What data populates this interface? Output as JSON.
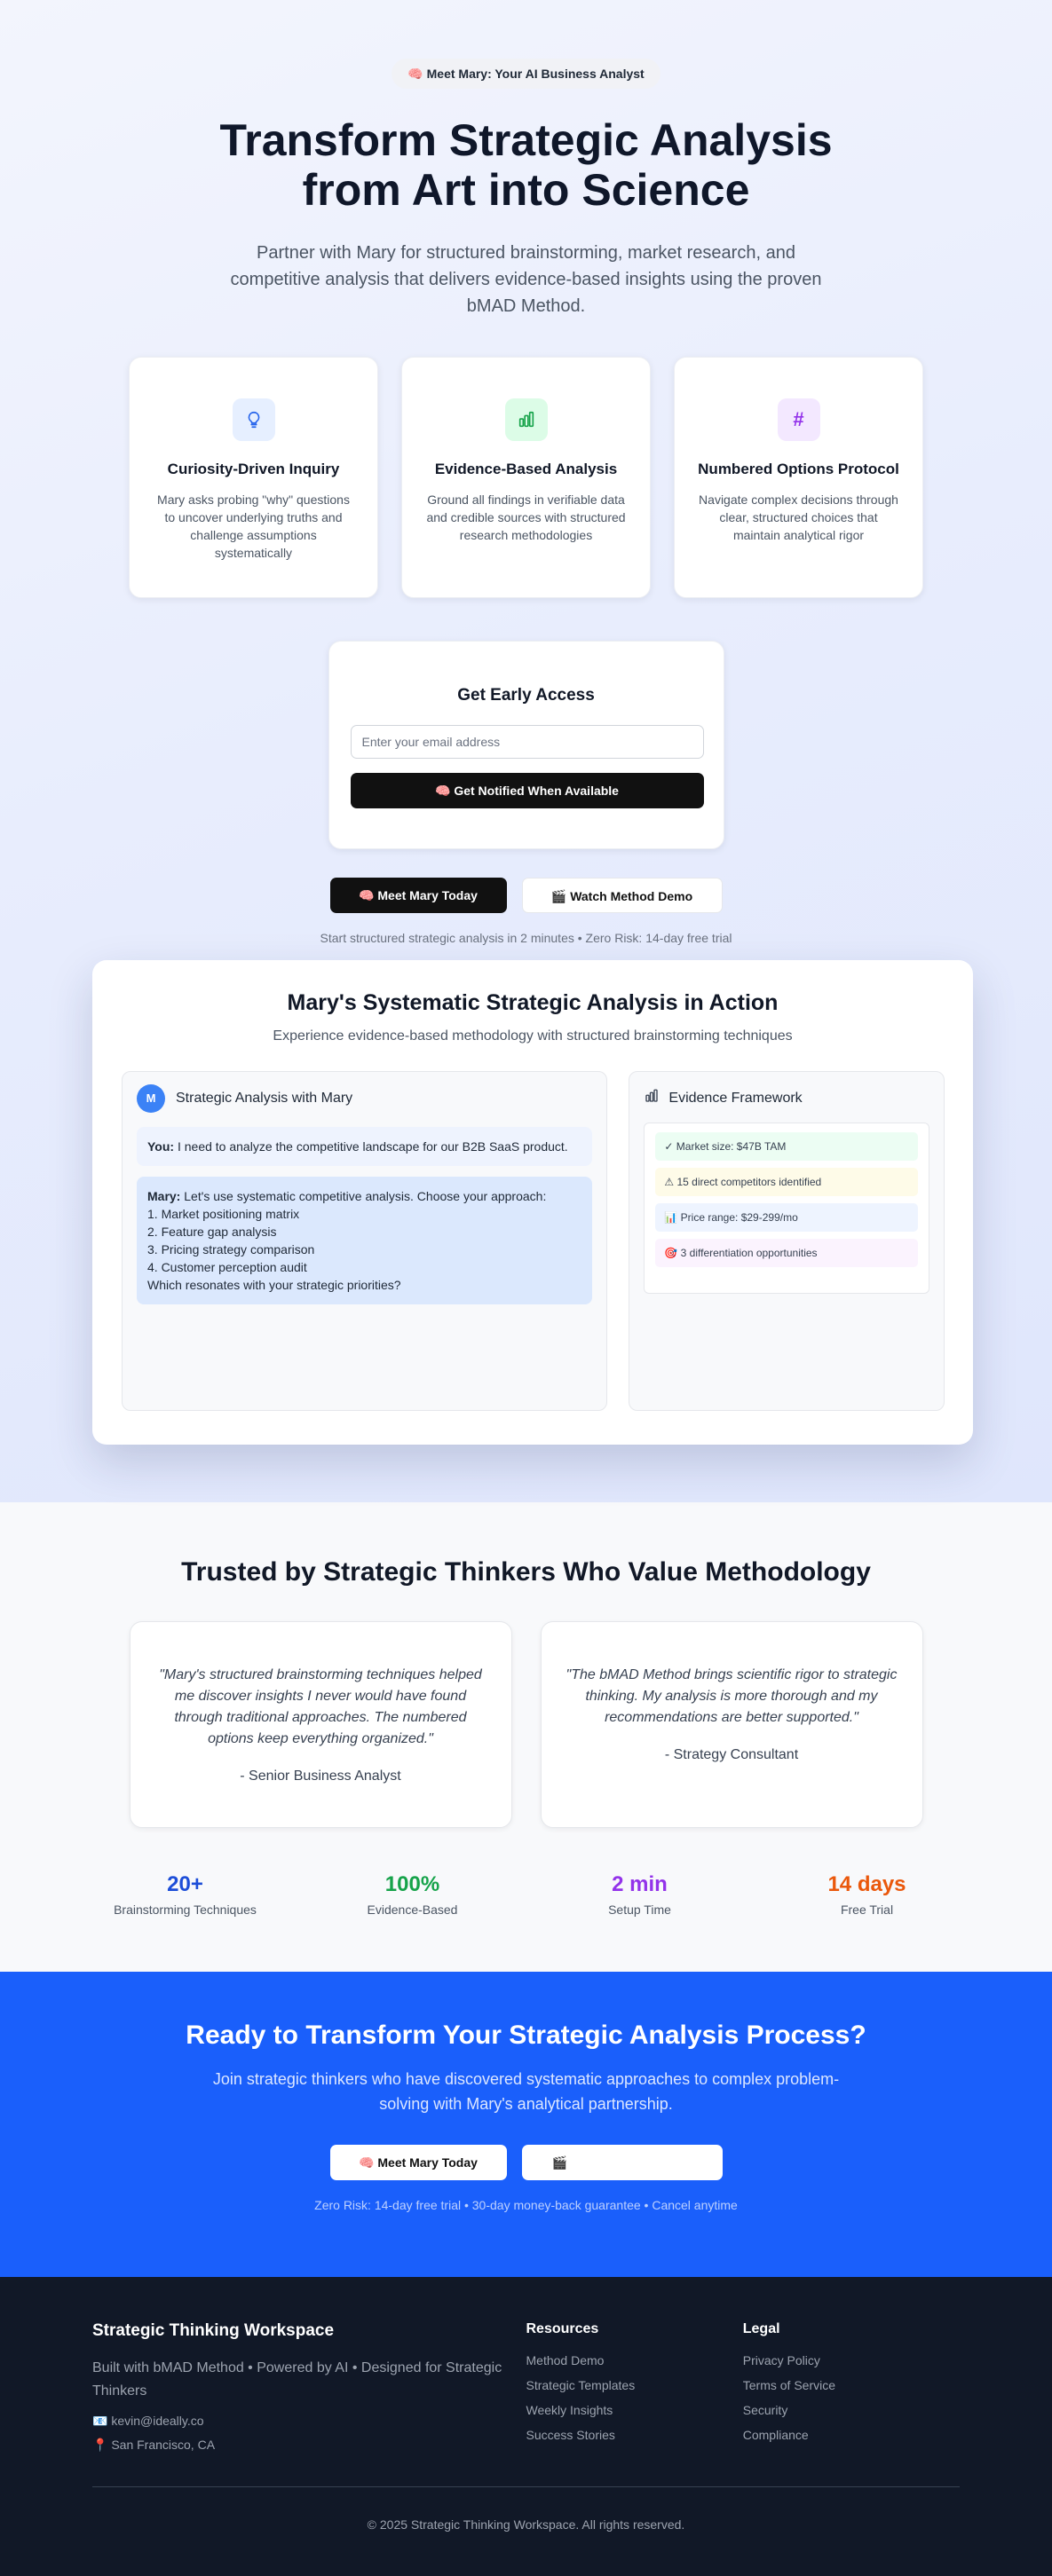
{
  "hero": {
    "badge": "🧠 Meet Mary: Your AI Business Analyst",
    "title": "Transform Strategic Analysis from Art into Science",
    "subtitle": "Partner with Mary for structured brainstorming, market research, and competitive analysis that delivers evidence-based insights using the proven bMAD Method."
  },
  "features": [
    {
      "icon": "lightbulb-icon",
      "title": "Curiosity-Driven Inquiry",
      "text": "Mary asks probing \"why\" questions to uncover underlying truths and challenge assumptions systematically"
    },
    {
      "icon": "bar-chart-icon",
      "title": "Evidence-Based Analysis",
      "text": "Ground all findings in verifiable data and credible sources with structured research methodologies"
    },
    {
      "icon": "hash-icon",
      "title": "Numbered Options Protocol",
      "text": "Navigate complex decisions through clear, structured choices that maintain analytical rigor"
    }
  ],
  "access": {
    "title": "Get Early Access",
    "email_placeholder": "Enter your email address",
    "button": "🧠 Get Notified When Available"
  },
  "cta": {
    "primary": "🧠 Meet Mary Today",
    "secondary": "🎬 Watch Method Demo",
    "fine": "Start structured strategic analysis in 2 minutes • Zero Risk: 14-day free trial"
  },
  "demo": {
    "title": "Mary's Systematic Strategic Analysis in Action",
    "subtitle": "Experience evidence-based methodology with structured brainstorming techniques",
    "chat_title": "Strategic Analysis with Mary",
    "avatar": "M",
    "user_label": "You:",
    "user_msg": "I need to analyze the competitive landscape for our B2B SaaS product.",
    "mary_label": "Mary:",
    "mary_intro": "Let's use systematic competitive analysis. Choose your approach:",
    "mary_options": [
      "1. Market positioning matrix",
      "2. Feature gap analysis",
      "3. Pricing strategy comparison",
      "4. Customer perception audit"
    ],
    "mary_outro": "Which resonates with your strategic priorities?",
    "evidence_title": "Evidence Framework",
    "evidence_items": [
      {
        "text": "✓ Market size: $47B TAM",
        "color": "#ecfdf3"
      },
      {
        "text": "⚠ 15 direct competitors identified",
        "color": "#fefbe8"
      },
      {
        "text": "📊 Price range: $29-299/mo",
        "color": "#eef4ff"
      },
      {
        "text": "🎯 3 differentiation opportunities",
        "color": "#fbf3fe"
      }
    ]
  },
  "trust": {
    "title": "Trusted by Strategic Thinkers Who Value Methodology",
    "quotes": [
      {
        "text": "\"Mary's structured brainstorming techniques helped me discover insights I never would have found through traditional approaches. The numbered options keep everything organized.\"",
        "author": "- Senior Business Analyst"
      },
      {
        "text": "\"The bMAD Method brings scientific rigor to strategic thinking. My analysis is more thorough and my recommendations are better supported.\"",
        "author": "- Strategy Consultant"
      }
    ],
    "stats": [
      {
        "value": "20+",
        "label": "Brainstorming Techniques",
        "color": "#1d4ed8"
      },
      {
        "value": "100%",
        "label": "Evidence-Based",
        "color": "#16a34a"
      },
      {
        "value": "2 min",
        "label": "Setup Time",
        "color": "#9333ea"
      },
      {
        "value": "14 days",
        "label": "Free Trial",
        "color": "#ea580c"
      }
    ]
  },
  "bottom_cta": {
    "title": "Ready to Transform Your Strategic Analysis Process?",
    "subtitle": "Join strategic thinkers who have discovered systematic approaches to complex problem-solving with Mary's analytical partnership.",
    "primary": "🧠 Meet Mary Today",
    "secondary": "🎬",
    "fine": "Zero Risk: 14-day free trial • 30-day money-back guarantee • Cancel anytime"
  },
  "footer": {
    "brand": "Strategic Thinking Workspace",
    "tagline": "Built with bMAD Method • Powered by AI • Designed for Strategic Thinkers",
    "email": "📧 kevin@ideally.co",
    "location": "📍 San Francisco, CA",
    "resources_title": "Resources",
    "resources": [
      "Method Demo",
      "Strategic Templates",
      "Weekly Insights",
      "Success Stories"
    ],
    "legal_title": "Legal",
    "legal": [
      "Privacy Policy",
      "Terms of Service",
      "Security",
      "Compliance"
    ],
    "copyright": "© 2025 Strategic Thinking Workspace. All rights reserved."
  }
}
